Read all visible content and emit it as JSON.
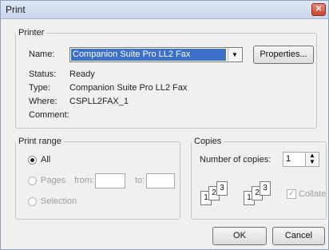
{
  "window": {
    "title": "Print",
    "close_label": "✕"
  },
  "printer": {
    "group_label": "Printer",
    "name_label": "Name:",
    "name_value": "Companion Suite Pro LL2 Fax",
    "properties_button": "Properties...",
    "status_label": "Status:",
    "status_value": "Ready",
    "type_label": "Type:",
    "type_value": "Companion Suite Pro LL2 Fax",
    "where_label": "Where:",
    "where_value": "CSPLL2FAX_1",
    "comment_label": "Comment:"
  },
  "print_range": {
    "group_label": "Print range",
    "all_label": "All",
    "pages_label": "Pages",
    "from_label": "from:",
    "to_label": "to:",
    "selection_label": "Selection",
    "selected": "All"
  },
  "copies": {
    "group_label": "Copies",
    "number_label": "Number of copies:",
    "number_value": "1",
    "collate_label": "Collate",
    "collate_checked": true,
    "pages": [
      "1",
      "2",
      "3"
    ]
  },
  "buttons": {
    "ok": "OK",
    "cancel": "Cancel"
  },
  "icons": [
    "close-icon",
    "dropdown-arrow-icon",
    "spinner-icon",
    "collate-pages-icon"
  ]
}
